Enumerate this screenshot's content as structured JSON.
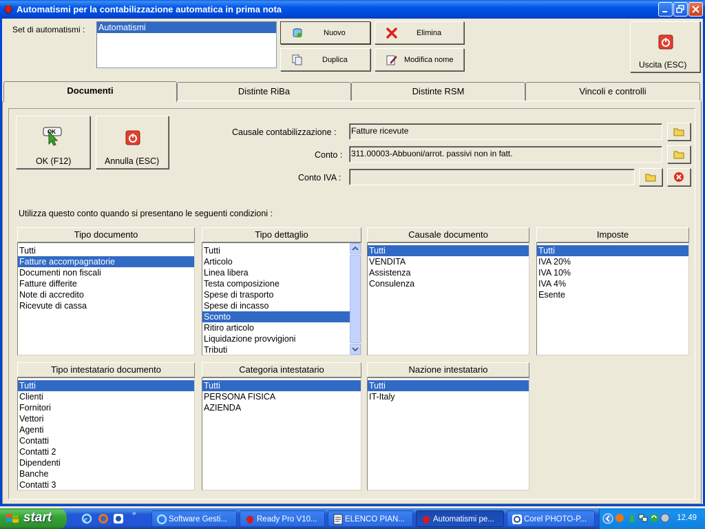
{
  "window": {
    "title": "Automatismi per la contabilizzazione automatica in prima nota"
  },
  "header": {
    "set_label": "Set di automatismi :",
    "set_items": [
      "Automatismi"
    ],
    "buttons": {
      "nuovo": "Nuovo",
      "elimina": "Elimina",
      "duplica": "Duplica",
      "modifica": "Modifica nome",
      "uscita": "Uscita (ESC)"
    }
  },
  "tabs": [
    "Documenti",
    "Distinte RiBa",
    "Distinte RSM",
    "Vincoli e controlli"
  ],
  "form": {
    "ok_label": "OK (F12)",
    "annulla_label": "Annulla (ESC)",
    "causale_label": "Causale contabilizzazione :",
    "causale_value": "Fatture ricevute",
    "conto_label": "Conto :",
    "conto_value": "311.00003-Abbuoni/arrot. passivi non in fatt.",
    "contoiva_label": "Conto IVA :",
    "contoiva_value": "",
    "condizioni_text": "Utilizza questo conto quando si presentano le seguenti condizioni :"
  },
  "lists": {
    "tipo_documento": {
      "title": "Tipo documento",
      "items": [
        "Tutti",
        "Fatture accompagnatorie",
        "Documenti non fiscali",
        "Fatture differite",
        "Note di accredito",
        "Ricevute di cassa"
      ]
    },
    "tipo_dettaglio": {
      "title": "Tipo dettaglio",
      "items": [
        "Tutti",
        "Articolo",
        "Linea libera",
        "Testa composizione",
        "Spese di trasporto",
        "Spese di incasso",
        "Sconto",
        "Ritiro articolo",
        "Liquidazione provvigioni",
        "Tributi"
      ]
    },
    "causale_documento": {
      "title": "Causale documento",
      "items": [
        "Tutti",
        "VENDITA",
        "Assistenza",
        "Consulenza"
      ]
    },
    "imposte": {
      "title": "Imposte",
      "items": [
        "Tutti",
        "IVA 20%",
        "IVA 10%",
        "IVA 4%",
        "Esente"
      ]
    },
    "tipo_intestatario": {
      "title": "Tipo intestatario documento",
      "items": [
        "Tutti",
        "Clienti",
        "Fornitori",
        "Vettori",
        "Agenti",
        "Contatti",
        "Contatti 2",
        "Dipendenti",
        "Banche",
        "Contatti 3"
      ]
    },
    "categoria_intestatario": {
      "title": "Categoria intestatario",
      "items": [
        "Tutti",
        "PERSONA FISICA",
        "AZIENDA"
      ]
    },
    "nazione_intestatario": {
      "title": "Nazione intestatario",
      "items": [
        "Tutti",
        "IT-Italy"
      ]
    }
  },
  "taskbar": {
    "start_label": "start",
    "tasks": [
      "Software Gesti...",
      "Ready Pro V10...",
      "ELENCO PIAN...",
      "Automatismi pe...",
      "Corel PHOTO-P..."
    ],
    "clock": "12.49"
  },
  "icons": {
    "app": "strawberry-icon",
    "nuovo": "new-db-icon",
    "elimina": "red-x-icon",
    "duplica": "duplicate-icon",
    "modifica": "edit-icon",
    "uscita": "exit-icon",
    "ok": "ok-cursor-icon",
    "folder": "folder-icon",
    "clear": "clear-icon"
  }
}
